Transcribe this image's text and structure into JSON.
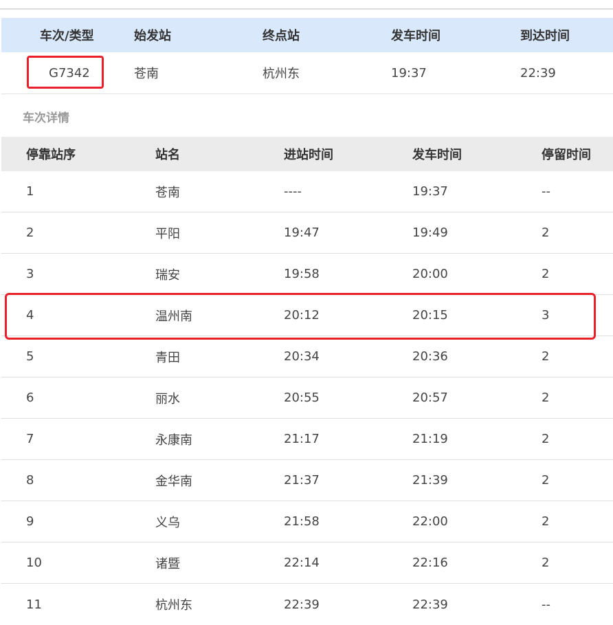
{
  "summary": {
    "headers": [
      "车次/类型",
      "始发站",
      "终点站",
      "发车时间",
      "到达时间"
    ],
    "train_no": "G7342",
    "origin": "苍南",
    "destination": "杭州东",
    "depart_time": "19:37",
    "arrive_time": "22:39"
  },
  "details_title": "车次详情",
  "stops": {
    "headers": [
      "停靠站序",
      "站名",
      "进站时间",
      "发车时间",
      "停留时间"
    ],
    "rows": [
      {
        "seq": "1",
        "station": "苍南",
        "arrive": "----",
        "depart": "19:37",
        "stay": "--"
      },
      {
        "seq": "2",
        "station": "平阳",
        "arrive": "19:47",
        "depart": "19:49",
        "stay": "2"
      },
      {
        "seq": "3",
        "station": "瑞安",
        "arrive": "19:58",
        "depart": "20:00",
        "stay": "2"
      },
      {
        "seq": "4",
        "station": "温州南",
        "arrive": "20:12",
        "depart": "20:15",
        "stay": "3"
      },
      {
        "seq": "5",
        "station": "青田",
        "arrive": "20:34",
        "depart": "20:36",
        "stay": "2"
      },
      {
        "seq": "6",
        "station": "丽水",
        "arrive": "20:55",
        "depart": "20:57",
        "stay": "2"
      },
      {
        "seq": "7",
        "station": "永康南",
        "arrive": "21:17",
        "depart": "21:19",
        "stay": "2"
      },
      {
        "seq": "8",
        "station": "金华南",
        "arrive": "21:37",
        "depart": "21:39",
        "stay": "2"
      },
      {
        "seq": "9",
        "station": "义乌",
        "arrive": "21:58",
        "depart": "22:00",
        "stay": "2"
      },
      {
        "seq": "10",
        "station": "诸暨",
        "arrive": "22:14",
        "depart": "22:16",
        "stay": "2"
      },
      {
        "seq": "11",
        "station": "杭州东",
        "arrive": "22:39",
        "depart": "22:39",
        "stay": "--"
      }
    ]
  },
  "colors": {
    "summary_header_bg": "#d9e9fb",
    "stops_header_bg": "#ebebeb",
    "highlight": "#e8202a"
  }
}
